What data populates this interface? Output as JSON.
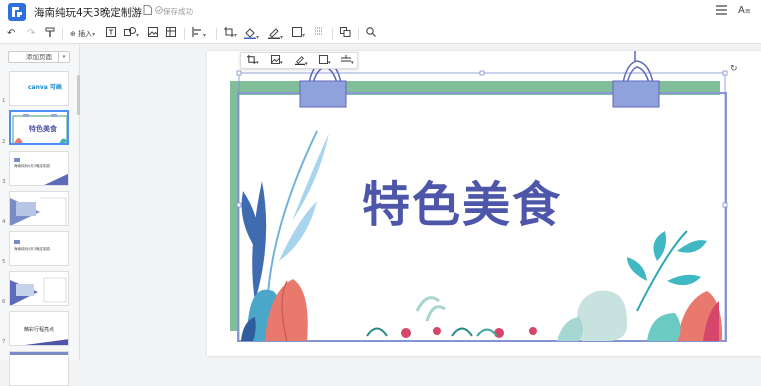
{
  "app": {
    "doc_title": "海南纯玩4天3晚定制游",
    "save_status": "保存成功"
  },
  "toolbar": {
    "insert_label": "插入"
  },
  "sidebar": {
    "add_page_label": "添加页面",
    "thumbs": [
      {
        "num": "1",
        "text": "canva 可画"
      },
      {
        "num": "2",
        "text": "特色美食"
      },
      {
        "num": "3",
        "text": "海南纯玩4天3晚定制游"
      },
      {
        "num": "4",
        "text": ""
      },
      {
        "num": "5",
        "text": "海南纯玩4天3晚定制游"
      },
      {
        "num": "6",
        "text": ""
      },
      {
        "num": "7",
        "text": "精彩行程亮点"
      },
      {
        "num": "8",
        "text": ""
      }
    ]
  },
  "slide": {
    "headline": "特色美食"
  },
  "colors": {
    "accent": "#4f8ef7",
    "headline": "#4d56a8",
    "frame_green": "#82bd9a",
    "frame_blue": "#a4b3e0"
  }
}
